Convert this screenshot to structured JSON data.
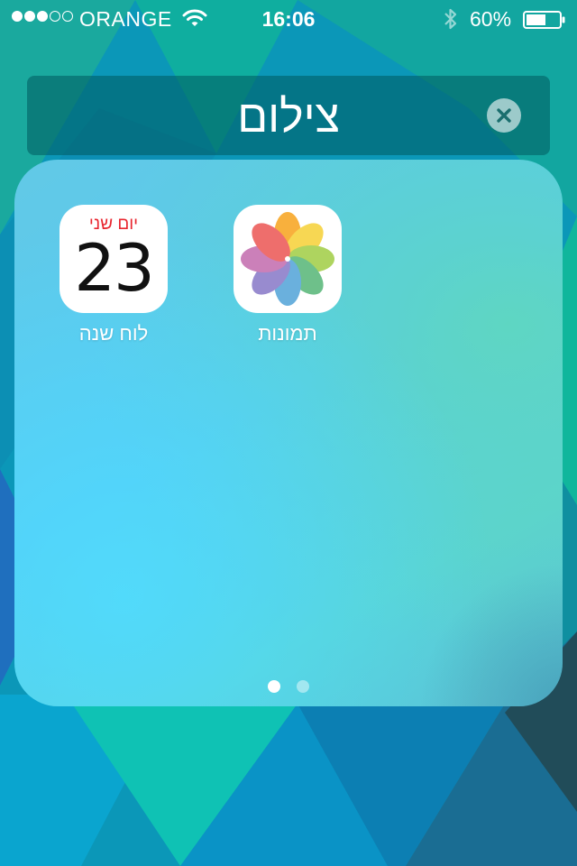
{
  "status_bar": {
    "signal_bars": 3,
    "signal_total": 5,
    "carrier": "ORANGE",
    "time": "16:06",
    "battery_percent": "60%",
    "battery_level": 0.6,
    "icons": [
      "wifi-icon",
      "bluetooth-icon",
      "battery-icon"
    ]
  },
  "folder": {
    "title": "צילום",
    "clear_icon": "close-icon",
    "apps": [
      {
        "label": "לוח שנה",
        "icon": "calendar-icon",
        "calendar_day": "יום שני",
        "calendar_date": "23"
      },
      {
        "label": "תמונות",
        "icon": "photos-icon"
      }
    ],
    "page_count": 2,
    "current_page": 1
  },
  "colors": {
    "calendar_red": "#e8262f",
    "title_bar": "#005a5f",
    "wallpaper_teal": "#0aa0b6"
  }
}
